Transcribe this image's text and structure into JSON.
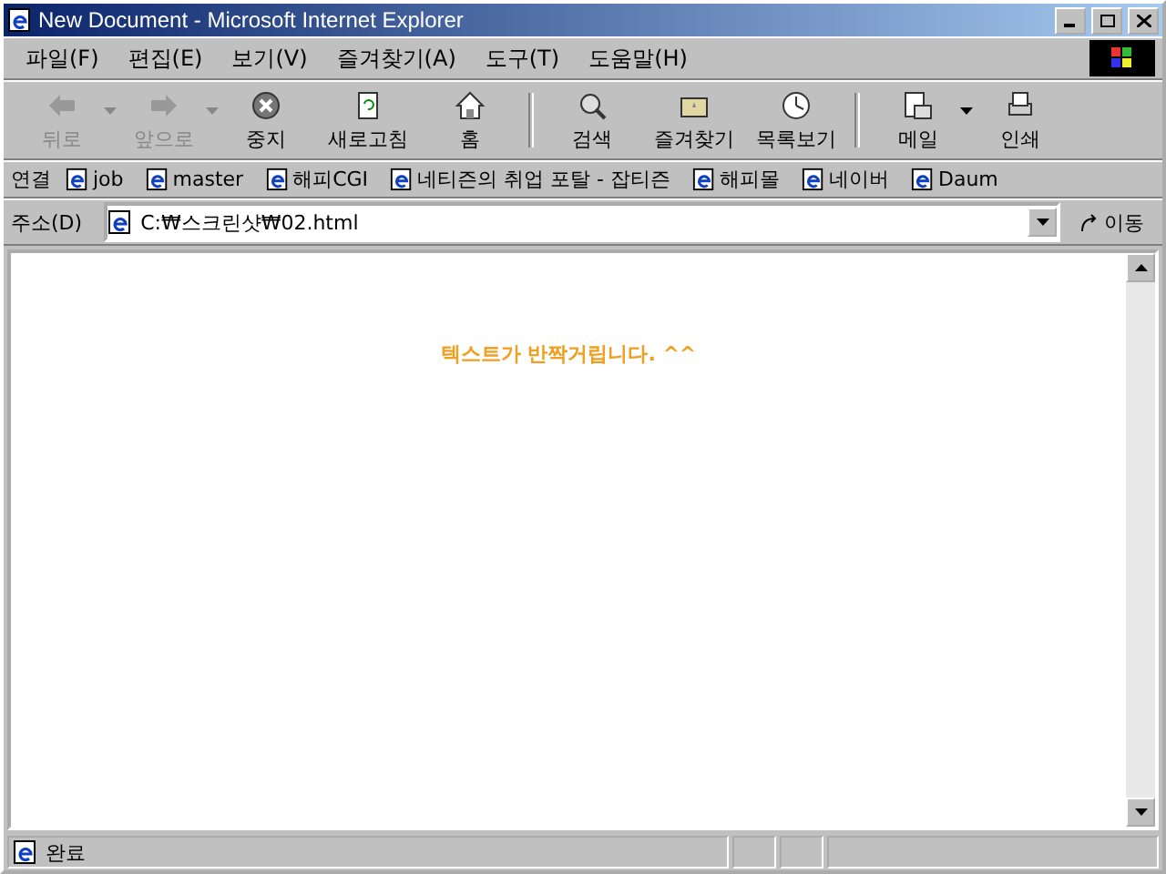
{
  "window": {
    "title": "New Document - Microsoft Internet Explorer"
  },
  "menu": [
    "파일(F)",
    "편집(E)",
    "보기(V)",
    "즐겨찾기(A)",
    "도구(T)",
    "도움말(H)"
  ],
  "toolbar": [
    {
      "label": "뒤로",
      "kind": "back",
      "disabled": true,
      "dropdown": true
    },
    {
      "label": "앞으로",
      "kind": "forward",
      "disabled": true,
      "dropdown": true
    },
    {
      "label": "중지",
      "kind": "stop",
      "disabled": false,
      "dropdown": false
    },
    {
      "label": "새로고침",
      "kind": "refresh",
      "disabled": false,
      "dropdown": false
    },
    {
      "label": "홈",
      "kind": "home",
      "disabled": false,
      "dropdown": false
    },
    {
      "label": "검색",
      "kind": "search",
      "disabled": false,
      "dropdown": false,
      "group_start": true
    },
    {
      "label": "즐겨찾기",
      "kind": "favorites",
      "disabled": false,
      "dropdown": false
    },
    {
      "label": "목록보기",
      "kind": "history",
      "disabled": false,
      "dropdown": false
    },
    {
      "label": "메일",
      "kind": "mail",
      "disabled": false,
      "dropdown": true,
      "group_start": true
    },
    {
      "label": "인쇄",
      "kind": "print",
      "disabled": false,
      "dropdown": false
    }
  ],
  "links": {
    "label": "연결",
    "items": [
      "job",
      "master",
      "해피CGI",
      "네티즌의 취업 포탈 - 잡티즌",
      "해피몰",
      "네이버",
      "Daum"
    ]
  },
  "address": {
    "label": "주소(D)",
    "value": "C:₩스크린샷₩02.html",
    "go": "이동"
  },
  "page": {
    "message": "텍스트가 반짝거립니다. ^^"
  },
  "status_bar": {
    "text": "완료"
  }
}
